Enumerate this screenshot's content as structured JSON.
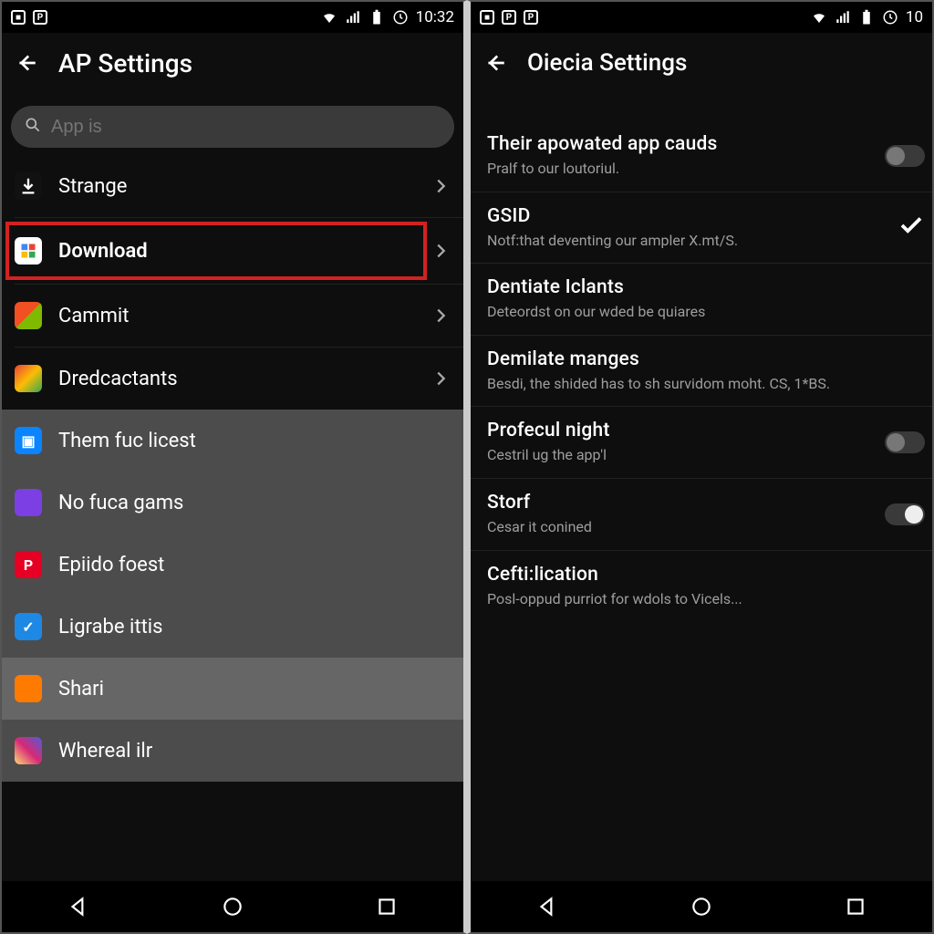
{
  "left": {
    "status": {
      "time": "10:32"
    },
    "header": {
      "title": "AP Settings"
    },
    "search": {
      "placeholder": "App is"
    },
    "items": [
      {
        "label": "Strange"
      },
      {
        "label": "Download"
      },
      {
        "label": "Cammit"
      },
      {
        "label": "Dredcactants"
      },
      {
        "label": "Them fuc licest"
      },
      {
        "label": "No fuca gams"
      },
      {
        "label": "Epiido foest"
      },
      {
        "label": "Ligrabe ittis"
      },
      {
        "label": "Shari"
      },
      {
        "label": "Whereal ilr"
      }
    ]
  },
  "right": {
    "status": {
      "time": "10"
    },
    "header": {
      "title": "Oiecia Settings"
    },
    "settings": [
      {
        "title": "Their apowated app cauds",
        "sub": "Pralf to our loutoriul."
      },
      {
        "title": "GSID",
        "sub": "Notf:that deventing our ampler X.mt/S."
      },
      {
        "title": "Dentiate Iclants",
        "sub": "Deteordst on our wded be quiares"
      },
      {
        "title": "Demilate manges",
        "sub": "Besdi, the shided has to sh survidom moht. CS, 1*BS."
      },
      {
        "title": "Profecul night",
        "sub": "Cestril ug the app'l"
      },
      {
        "title": "Storf",
        "sub": "Cesar it conined"
      },
      {
        "title": "Cefti:lication",
        "sub": "Posl-oppud purriot for wdols to Vicels..."
      }
    ]
  }
}
